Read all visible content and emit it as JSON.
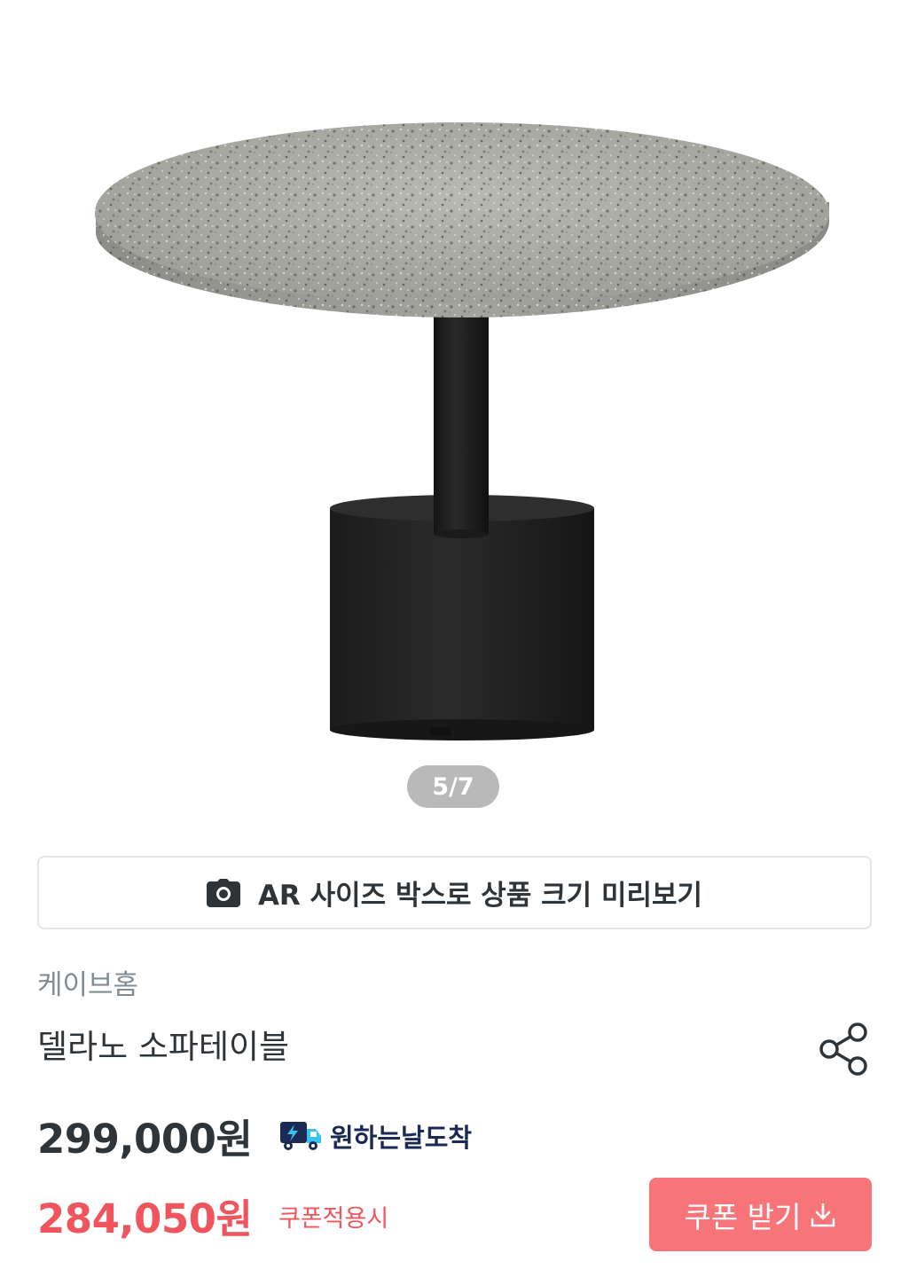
{
  "gallery": {
    "counter": "5/7",
    "image_alt": "terrazzo round sofa table with black pedestal base"
  },
  "ar_button": {
    "label": "AR 사이즈 박스로 상품 크기 미리보기",
    "icon": "camera-icon"
  },
  "product": {
    "brand": "케이브홈",
    "name": "델라노 소파테이블"
  },
  "share": {
    "icon": "share-icon"
  },
  "pricing": {
    "original_price": "299,000원",
    "delivery_badge": "원하는날도착",
    "delivery_icon": "truck-lightning-icon",
    "sale_price": "284,050원",
    "coupon_note": "쿠폰적용시"
  },
  "coupon_button": {
    "label": "쿠폰 받기",
    "icon": "download-icon"
  },
  "colors": {
    "text_primary": "#2f3438",
    "text_secondary": "#828c94",
    "sale_red": "#f0555d",
    "coupon_bg": "#f77479",
    "border": "#e3e5e8",
    "delivery_navy": "#1b2a55",
    "delivery_blue": "#35c5f0"
  }
}
